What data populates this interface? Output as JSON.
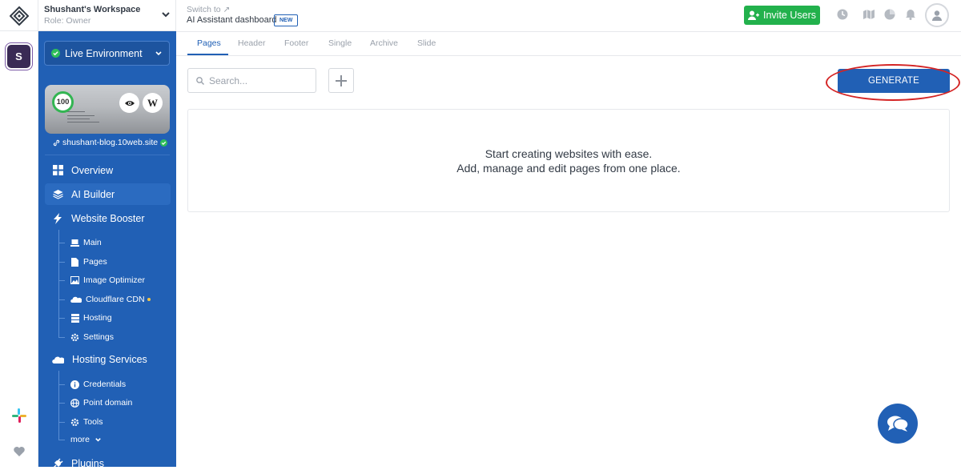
{
  "workspace": {
    "name": "Shushant's Workspace",
    "role": "Role: Owner",
    "avatar_letter": "S"
  },
  "environment": {
    "label": "Live Environment"
  },
  "site": {
    "score": "100",
    "url": "shushant-blog.10web.site"
  },
  "sidebar": {
    "items": [
      {
        "label": "Overview",
        "icon": "grid-icon"
      },
      {
        "label": "AI Builder",
        "icon": "layers-icon"
      },
      {
        "label": "Website Booster",
        "icon": "bolt-icon"
      }
    ],
    "booster_subitems": [
      {
        "label": "Main",
        "icon": "laptop-icon"
      },
      {
        "label": "Pages",
        "icon": "page-icon"
      },
      {
        "label": "Image Optimizer",
        "icon": "image-icon"
      },
      {
        "label": "Cloudflare CDN",
        "icon": "cloud-icon"
      },
      {
        "label": "Hosting",
        "icon": "server-icon"
      },
      {
        "label": "Settings",
        "icon": "gear-icon"
      }
    ],
    "hosting_services": {
      "label": "Hosting Services",
      "icon": "cloud-icon"
    },
    "hosting_subitems": [
      {
        "label": "Credentials",
        "icon": "info-icon"
      },
      {
        "label": "Point domain",
        "icon": "globe-icon"
      },
      {
        "label": "Tools",
        "icon": "gear-icon"
      }
    ],
    "more_label": "more",
    "plugins_label": "Plugins"
  },
  "header": {
    "switch_to": "Switch to ↗",
    "title": "AI Assistant dashboard",
    "badge": "NEW",
    "invite_label": "Invite Users"
  },
  "tabs": [
    "Pages",
    "Header",
    "Footer",
    "Single",
    "Archive",
    "Slide"
  ],
  "toolbar": {
    "search_placeholder": "Search...",
    "generate_label": "GENERATE"
  },
  "empty_state": {
    "line1": "Start creating websites with ease.",
    "line2": "Add, manage and edit pages from one place."
  },
  "colors": {
    "primary": "#2160b5",
    "success": "#22b14c",
    "highlight": "#d42424"
  }
}
